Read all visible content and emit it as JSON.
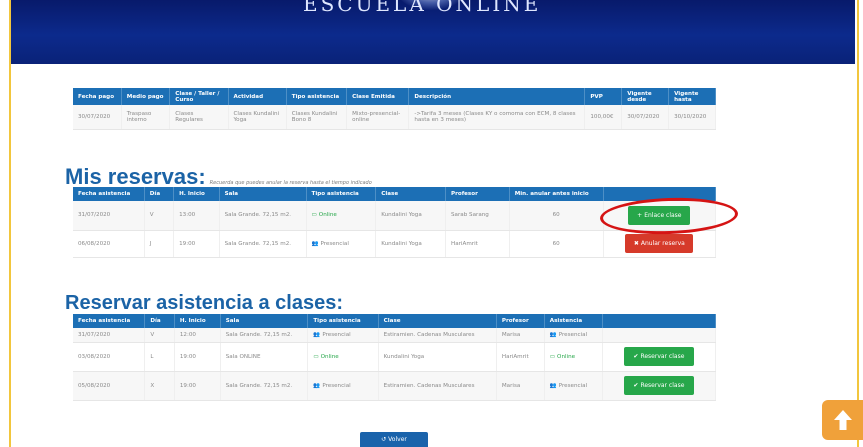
{
  "banner": {
    "logo_text": "ESCUELA ONLINE"
  },
  "purchase_table": {
    "headers": [
      "Fecha pago",
      "Medio pago",
      "Clase / Taller / Curso",
      "Actividad",
      "Tipo asistencia",
      "Clase Emitida",
      "Descripción",
      "PVP",
      "Vigente desde",
      "Vigente hasta"
    ],
    "row": [
      "30/07/2020",
      "Traspaso interno",
      "Clases Regulares",
      "Clases Kundalini Yoga",
      "Clases Kundalini Bono 8",
      "Mixto-presencial-online",
      "->Tarifa 3 meses (Clases KY o comoma con ECM, 8 clases hasta en 3 meses)",
      "100,00€",
      "30/07/2020",
      "30/10/2020"
    ]
  },
  "reservas": {
    "title": "Mis reservas:",
    "hint": "Recuerda que puedes anular la reserva hasta el tiempo indicado",
    "headers": [
      "Fecha asistencia",
      "Día",
      "H. Inicio",
      "Sala",
      "Tipo asistencia",
      "Clase",
      "Profesor",
      "Min. anular antes inicio",
      ""
    ],
    "rows": [
      {
        "fecha": "31/07/2020",
        "dia": "V",
        "hora": "13:00",
        "sala": "Sala Grande. 72,15 m2.",
        "tipo": "Online",
        "clase": "Kundalini Yoga",
        "profesor": "Sarab Sarang",
        "min": "60",
        "action": "Enlace clase"
      },
      {
        "fecha": "06/08/2020",
        "dia": "J",
        "hora": "19:00",
        "sala": "Sala Grande. 72,15 m2.",
        "tipo": "Presencial",
        "clase": "Kundalini Yoga",
        "profesor": "HariAmrit",
        "min": "60",
        "action": "Anular reserva"
      }
    ]
  },
  "reservar": {
    "title": "Reservar asistencia a clases:",
    "headers": [
      "Fecha asistencia",
      "Día",
      "H. Inicio",
      "Sala",
      "Tipo asistencia",
      "Clase",
      "Profesor",
      "Asistencia",
      ""
    ],
    "rows": [
      {
        "fecha": "31/07/2020",
        "dia": "V",
        "hora": "12:00",
        "sala": "Sala Grande. 72,15 m2.",
        "tipo": "Presencial",
        "clase": "Estiramien. Cadenas Musculares",
        "profesor": "Marisa",
        "asistencia": "Presencial",
        "action": ""
      },
      {
        "fecha": "03/08/2020",
        "dia": "L",
        "hora": "19:00",
        "sala": "Sala ONLINE",
        "tipo": "Online",
        "clase": "Kundalini Yoga",
        "profesor": "HariAmrit",
        "asistencia": "Online",
        "action": "Reservar clase"
      },
      {
        "fecha": "05/08/2020",
        "dia": "X",
        "hora": "19:00",
        "sala": "Sala Grande. 72,15 m2.",
        "tipo": "Presencial",
        "clase": "Estiramien. Cadenas Musculares",
        "profesor": "Marisa",
        "asistencia": "Presencial",
        "action": "Reservar clase"
      }
    ]
  },
  "back_button": {
    "label": "Volver"
  },
  "colors": {
    "header_blue": "#1c6fb5",
    "title_blue": "#1b63a6",
    "green": "#27a74a",
    "red": "#d63a2a",
    "annotation_red": "#d51414",
    "scroll_orange": "#f0a13a",
    "border_yellow": "#f2c63d"
  }
}
